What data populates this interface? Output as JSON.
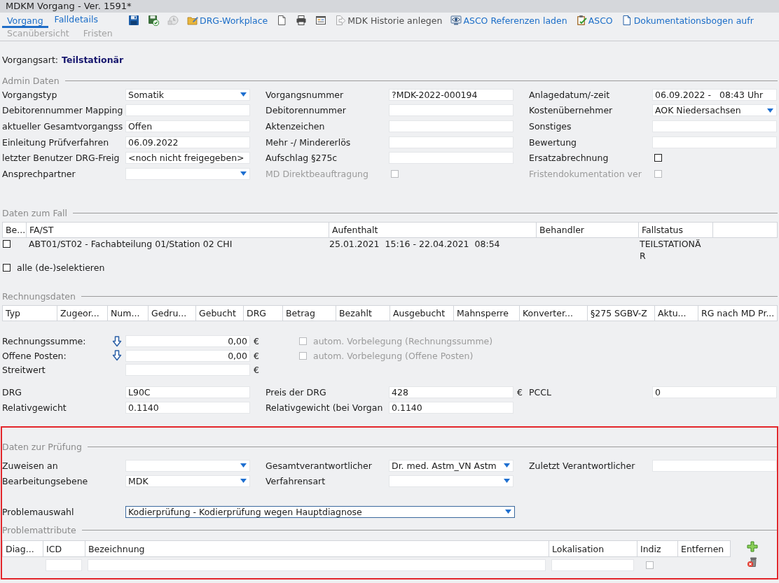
{
  "window": {
    "title": "MDKM Vorgang - Ver. 1591*"
  },
  "tab_rows": [
    {
      "tabs": [
        {
          "label": "Vorgang",
          "selected": true,
          "disabled": false
        },
        {
          "label": "Falldetails",
          "selected": false,
          "disabled": false
        }
      ]
    },
    {
      "tabs": [
        {
          "label": "Scanübersicht",
          "selected": false,
          "disabled": true
        },
        {
          "label": "Fristen",
          "selected": false,
          "disabled": true
        }
      ]
    }
  ],
  "toolbar": [
    {
      "kind": "save",
      "disabled": false
    },
    {
      "kind": "savecheck",
      "disabled": false
    },
    {
      "kind": "clock",
      "disabled": true
    },
    {
      "kind": "folder",
      "label": "DRG-Workplace",
      "disabled": false
    },
    {
      "kind": "page",
      "disabled": false
    },
    {
      "kind": "printer",
      "disabled": false
    },
    {
      "kind": "form",
      "disabled": false
    },
    {
      "kind": "export",
      "label": "MDK Historie anlegen",
      "disabled": true
    },
    {
      "kind": "eye",
      "label": "ASCO Referenzen laden",
      "disabled": false
    },
    {
      "kind": "clipboard",
      "label": "ASCO",
      "disabled": false
    },
    {
      "kind": "document",
      "label": "Dokumentationsbogen aufr",
      "disabled": false
    }
  ],
  "case_type": {
    "label": "Vorgangsart:",
    "value": "Teilstationär"
  },
  "admin": {
    "title": "Admin Daten",
    "rows": [
      {
        "cells": [
          {
            "kind": "select",
            "label": "Vorgangstyp",
            "value": "Somatik"
          },
          {
            "kind": "text",
            "label": "Vorgangsnummer",
            "value": "?MDK-2022-000194"
          },
          {
            "kind": "text",
            "label": "Anlagedatum/-zeit",
            "value": "06.09.2022 -   08:43 Uhr"
          }
        ]
      },
      {
        "cells": [
          {
            "kind": "text",
            "label": "Debitorennummer Mapping"
          },
          {
            "kind": "text",
            "label": "Debitorennummer"
          },
          {
            "kind": "select",
            "label": "Kostenübernehmer",
            "value": "AOK Niedersachsen"
          }
        ]
      },
      {
        "cells": [
          {
            "kind": "text",
            "label": "aktueller Gesamtvorgangss",
            "value": "Offen"
          },
          {
            "kind": "text",
            "label": "Aktenzeichen"
          },
          {
            "kind": "text",
            "label": "Sonstiges"
          }
        ]
      },
      {
        "cells": [
          {
            "kind": "text",
            "label": "Einleitung Prüfverfahren",
            "value": "06.09.2022"
          },
          {
            "kind": "text",
            "label": "Mehr -/ Mindererlös"
          },
          {
            "kind": "text",
            "label": "Bewertung"
          }
        ]
      },
      {
        "cells": [
          {
            "kind": "text",
            "label": "letzter Benutzer DRG-Freig",
            "value": "<noch nicht freigegeben>"
          },
          {
            "kind": "text",
            "label": "Aufschlag §275c"
          },
          {
            "kind": "checkbox",
            "label": "Ersatzabrechnung",
            "checked": false,
            "disabled": false
          }
        ]
      },
      {
        "cells": [
          {
            "kind": "select",
            "label": "Ansprechpartner"
          },
          {
            "kind": "checkbox",
            "label": "MD Direktbeauftragung",
            "checked": false,
            "disabled": true
          },
          {
            "kind": "checkbox",
            "label": "Fristendokumentation ver",
            "checked": false,
            "disabled": true
          }
        ]
      }
    ]
  },
  "case_data": {
    "title": "Daten zum Fall",
    "columns": [
      "Be...",
      "FA/ST",
      "Aufenthalt",
      "Behandler",
      "Fallstatus"
    ],
    "rows": [
      {
        "checked": false,
        "fa_st": "ABT01/ST02 - Fachabteilung 01/Station 02 CHI",
        "stay": "25.01.2021  15:16 - 22.04.2021  08:54",
        "status": "TEILSTATIONÄR"
      }
    ],
    "select_all": {
      "label": "alle (de-)selektieren",
      "checked": false
    }
  },
  "invoices": {
    "title": "Rechnungsdaten",
    "columns": [
      "Typ",
      "Zugeor...",
      "Num...",
      "Gedru...",
      "Gebucht",
      "DRG",
      "Betrag",
      "Bezahlt",
      "Ausgebucht",
      "Mahnsperre",
      "Konverter...",
      "§275 SGBV-Z",
      "Aktu...",
      "RG nach MD Pr..."
    ]
  },
  "totals": [
    {
      "kind": "auto",
      "label": "Rechnungssumme:",
      "value": "0,00",
      "unit": "€",
      "option": {
        "label": "autom. Vorbelegung (Rechnungssumme)",
        "checked": false,
        "disabled": true
      }
    },
    {
      "kind": "auto",
      "label": "Offene Posten:",
      "value": "0,00",
      "unit": "€",
      "option": {
        "label": "autom. Vorbelegung (Offene Posten)",
        "checked": false,
        "disabled": true
      }
    },
    {
      "kind": "plain",
      "label": "Streitwert",
      "unit": "€"
    }
  ],
  "drg": {
    "rows": [
      {
        "cells": [
          {
            "kind": "text",
            "label": "DRG",
            "value": "L90C"
          },
          {
            "kind": "text",
            "label": "Preis der DRG",
            "value": "428",
            "unit": "€"
          },
          {
            "kind": "text",
            "label": "PCCL",
            "value": "0"
          }
        ]
      },
      {
        "cells": [
          {
            "kind": "text",
            "label": "Relativgewicht",
            "value": "0.1140"
          },
          {
            "kind": "text",
            "label": "Relativgewicht (bei Vorgan",
            "value": "0.1140"
          }
        ]
      }
    ]
  },
  "review": {
    "title": "Daten zur Prüfung",
    "rows": [
      {
        "cells": [
          {
            "kind": "select",
            "label": "Zuweisen an"
          },
          {
            "kind": "select",
            "label": "Gesamtverantwortlicher",
            "value": "Dr. med. Astm_VN Astm"
          },
          {
            "kind": "text",
            "label": "Zuletzt Verantwortlicher"
          }
        ]
      },
      {
        "cells": [
          {
            "kind": "select",
            "label": "Bearbeitungsebene",
            "value": "MDK"
          },
          {
            "kind": "select",
            "label": "Verfahrensart"
          }
        ]
      }
    ],
    "problem": {
      "label": "Problemauswahl",
      "value": "Kodierprüfung - Kodierprüfung wegen Hauptdiagnose",
      "focused": true
    }
  },
  "problem_attributes": {
    "title": "Problemattribute",
    "columns": [
      {
        "label": "Diag...",
        "kind": "blank"
      },
      {
        "label": "ICD",
        "kind": "input"
      },
      {
        "label": "Bezeichnung",
        "kind": "input"
      },
      {
        "label": "Lokalisation",
        "kind": "input"
      },
      {
        "label": "Indiz",
        "kind": "checkbox"
      },
      {
        "label": "Entfernen",
        "kind": "blank"
      }
    ],
    "rows": [
      {
        "checked": false,
        "disabled": true
      }
    ]
  }
}
